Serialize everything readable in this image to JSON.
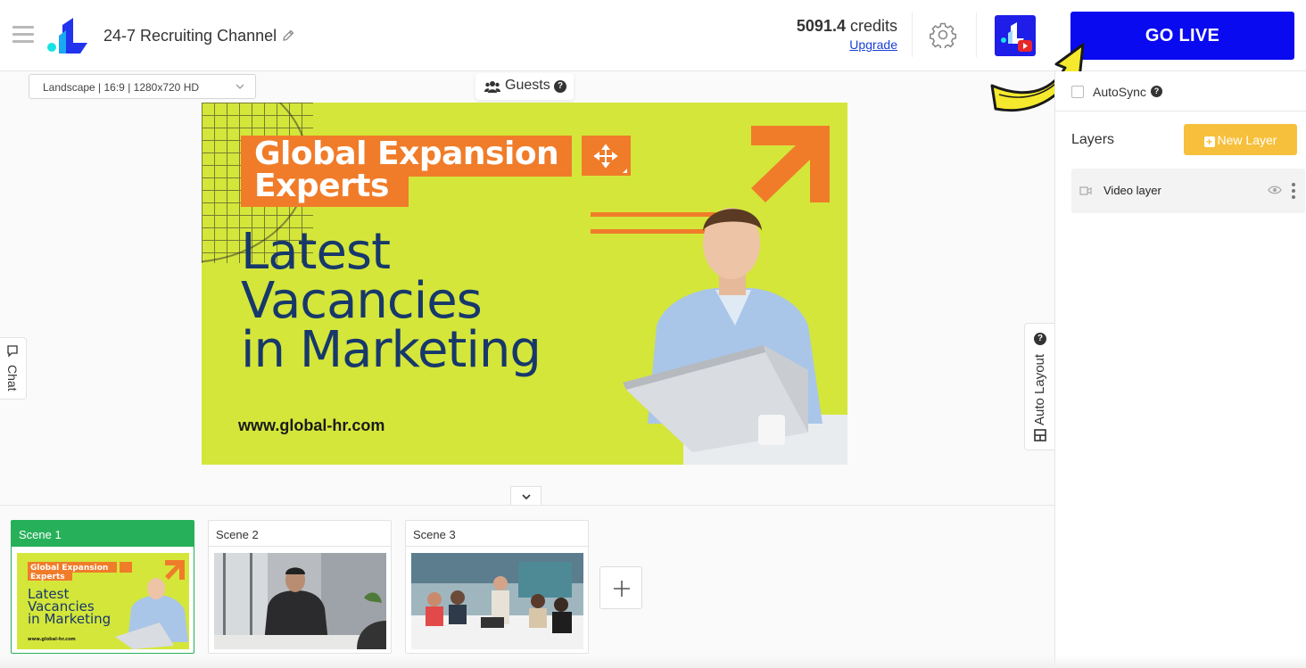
{
  "header": {
    "channel_name": "24-7 Recruiting Channel",
    "credits_value": "5091.4",
    "credits_label": "credits",
    "upgrade_label": "Upgrade",
    "go_live_label": "GO LIVE"
  },
  "stage": {
    "ratio_select_value": "Landscape | 16:9 | 1280x720 HD",
    "guests_label": "Guests",
    "help_glyph": "?"
  },
  "canvas": {
    "headline_line1": "Global Expansion",
    "headline_line2": "Experts",
    "main_line1": "Latest",
    "main_line2": "Vacancies",
    "main_line3": "in Marketing",
    "url": "www.global-hr.com"
  },
  "side_tabs": {
    "chat_label": "Chat",
    "auto_layout_label": "Auto Layout"
  },
  "right_panel": {
    "autosync_label": "AutoSync",
    "autosync_checked": false,
    "layers_title": "Layers",
    "new_layer_label": "New Layer",
    "layers": [
      {
        "name": "Video layer"
      }
    ]
  },
  "scenes": [
    {
      "label": "Scene 1",
      "active": true
    },
    {
      "label": "Scene 2",
      "active": false
    },
    {
      "label": "Scene 3",
      "active": false
    }
  ],
  "thumb_texts": {
    "scene1_head1": "Global Expansion",
    "scene1_head2": "Experts",
    "scene1_main1": "Latest",
    "scene1_main2": "Vacancies",
    "scene1_main3": "in Marketing",
    "scene1_url": "www.global-hr.com"
  },
  "colors": {
    "go_live": "#0a0af0",
    "scene_active": "#27b05a",
    "new_layer": "#f7c03c",
    "canvas_bg": "#d4e63a",
    "accent_orange": "#f07c2a",
    "headline_navy": "#17386b"
  }
}
